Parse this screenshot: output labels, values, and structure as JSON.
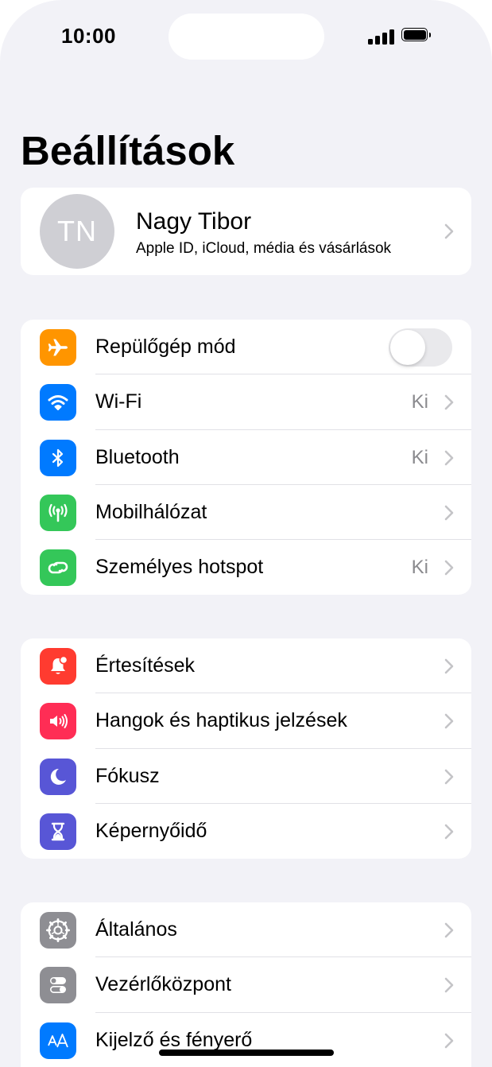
{
  "status": {
    "time": "10:00"
  },
  "title": "Beállítások",
  "profile": {
    "initials": "TN",
    "name": "Nagy Tibor",
    "subtitle": "Apple ID, iCloud, média és vásárlások"
  },
  "groups": [
    [
      {
        "label": "Repülőgép mód",
        "value": "",
        "icon": "airplane-icon",
        "color": "#ff9500",
        "toggle": false
      },
      {
        "label": "Wi-Fi",
        "value": "Ki",
        "icon": "wifi-icon",
        "color": "#007aff"
      },
      {
        "label": "Bluetooth",
        "value": "Ki",
        "icon": "bluetooth-icon",
        "color": "#007aff"
      },
      {
        "label": "Mobilhálózat",
        "value": "",
        "icon": "antenna-icon",
        "color": "#34c759"
      },
      {
        "label": "Személyes hotspot",
        "value": "Ki",
        "icon": "hotspot-icon",
        "color": "#34c759"
      }
    ],
    [
      {
        "label": "Értesítések",
        "value": "",
        "icon": "bell-icon",
        "color": "#ff3b30"
      },
      {
        "label": "Hangok és haptikus jelzések",
        "value": "",
        "icon": "speaker-icon",
        "color": "#ff2d55"
      },
      {
        "label": "Fókusz",
        "value": "",
        "icon": "moon-icon",
        "color": "#5856d6"
      },
      {
        "label": "Képernyőidő",
        "value": "",
        "icon": "hourglass-icon",
        "color": "#5856d6"
      }
    ],
    [
      {
        "label": "Általános",
        "value": "",
        "icon": "gear-icon",
        "color": "#8e8e93"
      },
      {
        "label": "Vezérlőközpont",
        "value": "",
        "icon": "switches-icon",
        "color": "#8e8e93"
      },
      {
        "label": "Kijelző és fényerő",
        "value": "",
        "icon": "text-size-icon",
        "color": "#007aff"
      }
    ]
  ]
}
